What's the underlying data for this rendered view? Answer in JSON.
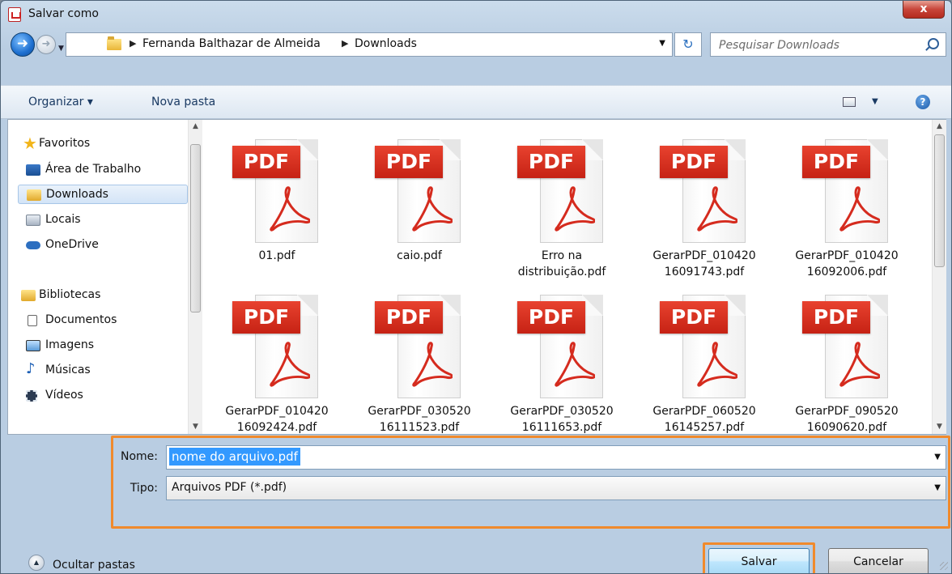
{
  "window": {
    "title": "Salvar como",
    "close_glyph": "x"
  },
  "nav": {
    "breadcrumb": [
      "Fernanda Balthazar de Almeida",
      "Downloads"
    ],
    "search_placeholder": "Pesquisar Downloads"
  },
  "toolbar": {
    "organize_label": "Organizar ▾",
    "new_folder_label": "Nova pasta"
  },
  "sidebar": {
    "favorites_label": "Favoritos",
    "favorites": [
      "Área de Trabalho",
      "Downloads",
      "Locais",
      "OneDrive"
    ],
    "libraries_label": "Bibliotecas",
    "libraries": [
      "Documentos",
      "Imagens",
      "Músicas",
      "Vídeos"
    ],
    "selected": "Downloads"
  },
  "files": {
    "badge_label": "PDF",
    "items": [
      [
        "01.pdf",
        ""
      ],
      [
        "caio.pdf",
        ""
      ],
      [
        "Erro na",
        "distribuição.pdf"
      ],
      [
        "GerarPDF_010420",
        "16091743.pdf"
      ],
      [
        "GerarPDF_010420",
        "16092006.pdf"
      ],
      [
        "GerarPDF_010420",
        "16092424.pdf"
      ],
      [
        "GerarPDF_030520",
        "16111523.pdf"
      ],
      [
        "GerarPDF_030520",
        "16111653.pdf"
      ],
      [
        "GerarPDF_060520",
        "16145257.pdf"
      ],
      [
        "GerarPDF_090520",
        "16090620.pdf"
      ]
    ]
  },
  "form": {
    "name_label": "Nome:",
    "name_value": "nome do arquivo.pdf",
    "type_label": "Tipo:",
    "type_value": "Arquivos PDF (*.pdf)"
  },
  "footer": {
    "hide_folders_label": "Ocultar pastas",
    "save_label": "Salvar",
    "cancel_label": "Cancelar"
  },
  "colors": {
    "highlight": "#f08a2c",
    "pdf_red": "#d52b1e",
    "selection": "#3399ff"
  }
}
